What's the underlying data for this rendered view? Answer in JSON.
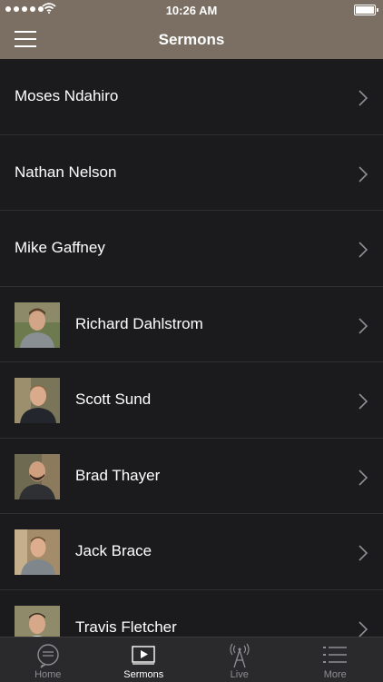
{
  "status": {
    "time": "10:26 AM"
  },
  "nav": {
    "title": "Sermons"
  },
  "speakers": [
    {
      "name": "Moses Ndahiro",
      "photo": false
    },
    {
      "name": "Nathan Nelson",
      "photo": false
    },
    {
      "name": "Mike Gaffney",
      "photo": false
    },
    {
      "name": "Richard Dahlstrom",
      "photo": true
    },
    {
      "name": "Scott Sund",
      "photo": true
    },
    {
      "name": "Brad Thayer",
      "photo": true
    },
    {
      "name": "Jack Brace",
      "photo": true
    },
    {
      "name": "Travis Fletcher",
      "photo": true
    }
  ],
  "tabs": [
    {
      "label": "Home",
      "icon": "chat-bubble-icon",
      "active": false
    },
    {
      "label": "Sermons",
      "icon": "video-play-icon",
      "active": true
    },
    {
      "label": "Live",
      "icon": "broadcast-tower-icon",
      "active": false
    },
    {
      "label": "More",
      "icon": "list-icon",
      "active": false
    }
  ],
  "colors": {
    "header": "#7a6f62",
    "background": "#1b1b1d",
    "tabbar": "#2a2a2c"
  }
}
